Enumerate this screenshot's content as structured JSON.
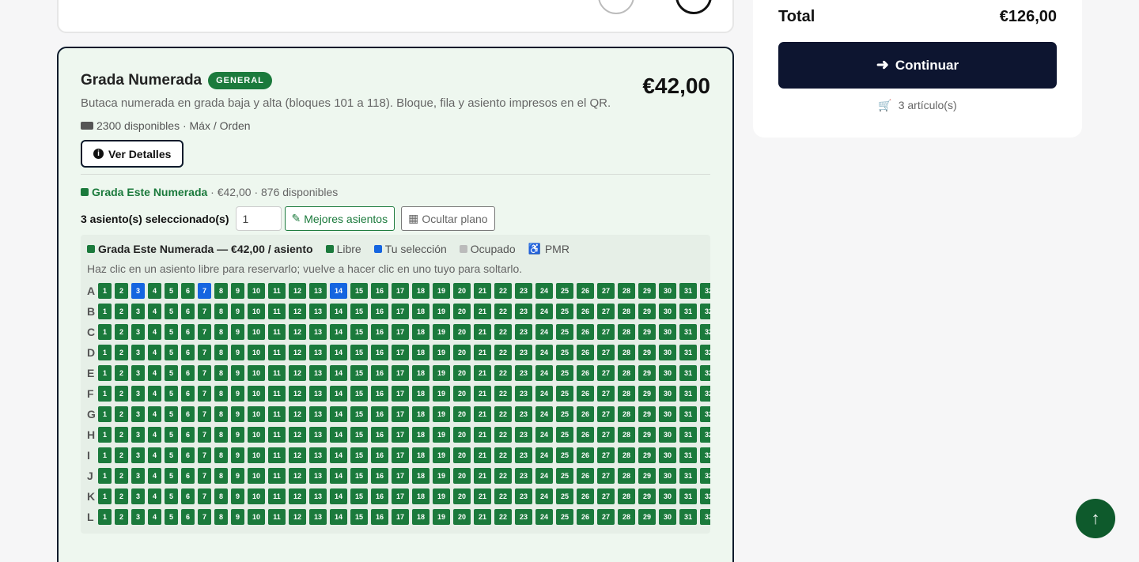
{
  "ticket": {
    "title": "Grada Numerada",
    "badge": "GENERAL",
    "price": "€42,00",
    "description": "Butaca numerada en grada baja y alta (bloques 101 a 118). Bloque, fila y asiento impresos en el QR.",
    "availability": "2300 disponibles · Máx / Orden",
    "details_label": "Ver Detalles",
    "section_name": "Grada Este Numerada",
    "section_info": " · €42,00 · 876 disponibles",
    "selected_label": "3 asiento(s) seleccionado(s)",
    "quantity_value": "1",
    "best_seats_label": "Mejores asientos",
    "hide_map_label": "Ocultar plano"
  },
  "seat_map": {
    "legend_title": "Grada Este Numerada — €42,00 / asiento",
    "legend_free": "Libre",
    "legend_selected": "Tu selección",
    "legend_occupied": "Ocupado",
    "legend_pmr": "PMR",
    "hint": "Haz clic en un asiento libre para reservarlo; vuelve a hacer clic en uno tuyo para soltarlo.",
    "rows": [
      "A",
      "B",
      "C",
      "D",
      "E",
      "F",
      "G",
      "H",
      "I",
      "J",
      "K",
      "L"
    ],
    "seats_per_row": 32,
    "selected": [
      {
        "row": "A",
        "seat": 3
      },
      {
        "row": "A",
        "seat": 7
      },
      {
        "row": "A",
        "seat": 14
      }
    ],
    "colors": {
      "free": "#1b7a3c",
      "selected": "#1565e0",
      "occupied": "#bbbbbb"
    }
  },
  "summary": {
    "total_label": "Total",
    "total_value": "€126,00",
    "continue_label": "Continuar",
    "items_count": "3 artículo(s)"
  }
}
